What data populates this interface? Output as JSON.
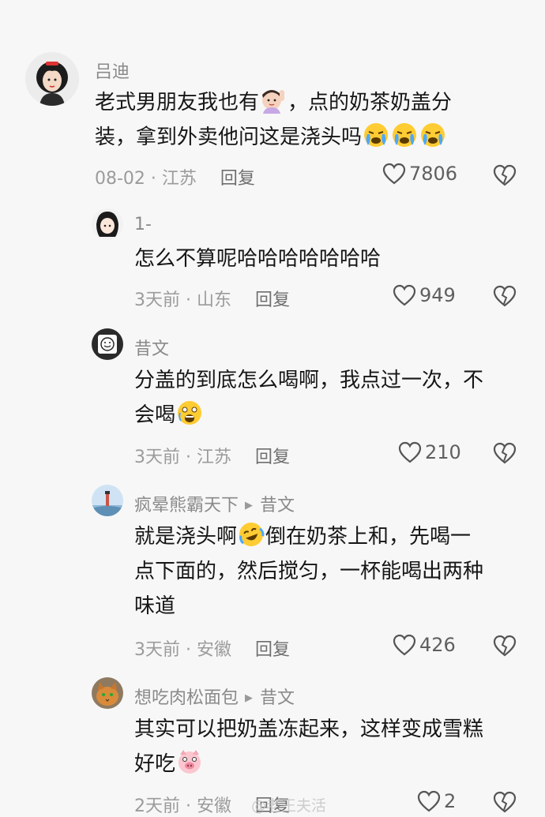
{
  "comments": [
    {
      "username": "吕迪",
      "text_line1": "老式男朋友我也有",
      "text_line1b": "，点的奶茶奶盖分",
      "text_line2": "装，拿到外卖他问这是浇头吗",
      "date_location": "08-02 · 江苏",
      "reply_label": "回复",
      "likes": "7806",
      "emojis": [
        "woman-raising-hand-emoji",
        "crying-emoji",
        "crying-emoji",
        "crying-emoji"
      ]
    },
    {
      "username": "1-",
      "text_line1": "怎么不算呢哈哈哈哈哈哈哈",
      "date_location": "3天前 · 山东",
      "reply_label": "回复",
      "likes": "949"
    },
    {
      "username": "昔文",
      "text_line1": "分盖的到底怎么喝啊，我点过一次，不",
      "text_line2": "会喝",
      "date_location": "3天前 · 江苏",
      "reply_label": "回复",
      "likes": "210",
      "emojis": [
        "shocked-emoji"
      ]
    },
    {
      "username": "疯晕熊霸天下",
      "reply_to": "昔文",
      "text_line1a": "就是浇头啊",
      "text_line1b": "倒在奶茶上和，先喝一",
      "text_line2": "点下面的，然后搅匀，一杯能喝出两种",
      "text_line3": "味道",
      "date_location": "3天前 · 安徽",
      "reply_label": "回复",
      "likes": "426",
      "emojis": [
        "laughing-crying-emoji"
      ]
    },
    {
      "username": "想吃肉松面包",
      "reply_to": "昔文",
      "text_line1": "其实可以把奶盖冻起来，这样变成雪糕",
      "text_line2": "好吃",
      "date_location": "2天前 · 安徽",
      "reply_label": "回复",
      "likes": "2",
      "emojis": [
        "pig-emoji"
      ]
    }
  ],
  "watermark": "@老王夫活"
}
